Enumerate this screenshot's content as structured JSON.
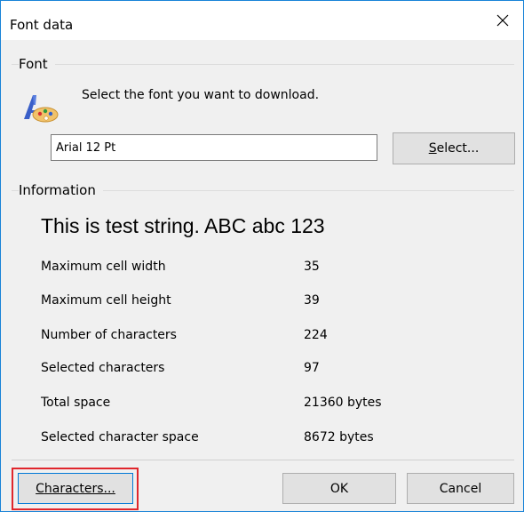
{
  "window": {
    "title": "Font data"
  },
  "font_group": {
    "label": "Font",
    "instruction": "Select the font you want to download.",
    "font_value": "Arial 12 Pt",
    "select_button": {
      "prefix": "",
      "mnemonic": "S",
      "rest": "elect..."
    }
  },
  "info_group": {
    "label": "Information",
    "sample_text": "This is test string. ABC abc 123",
    "rows": [
      {
        "label": "Maximum cell width",
        "value": "35"
      },
      {
        "label": "Maximum cell height",
        "value": "39"
      },
      {
        "label": "Number of characters",
        "value": "224"
      },
      {
        "label": "Selected characters",
        "value": "97"
      },
      {
        "label": "Total space",
        "value": "21360 bytes"
      },
      {
        "label": "Selected character space",
        "value": "8672 bytes"
      }
    ]
  },
  "buttons": {
    "characters": {
      "mnemonic": "C",
      "rest": "haracters..."
    },
    "ok": "OK",
    "cancel": "Cancel"
  },
  "icons": {
    "close": "close-icon",
    "font": "font-palette-icon"
  },
  "colors": {
    "window_border": "#1883d7",
    "highlight": "#e0262c",
    "button_bg": "#e1e1e1"
  }
}
